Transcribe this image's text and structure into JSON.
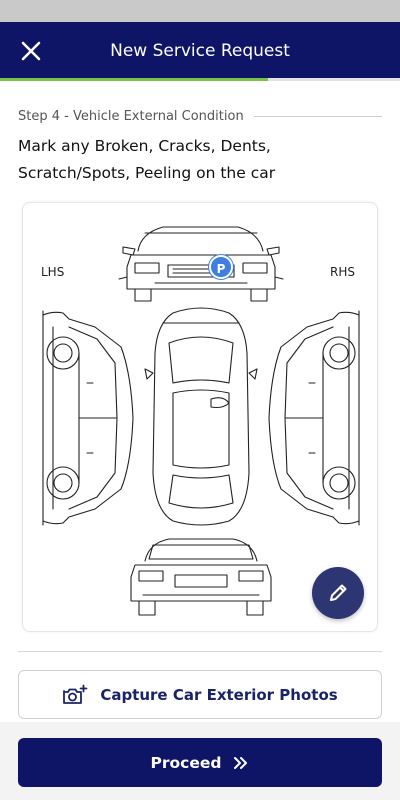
{
  "header": {
    "title": "New Service Request",
    "close_icon": "close-icon"
  },
  "progress": {
    "fraction": 0.67,
    "color": "#79c246"
  },
  "step": {
    "label": "Step 4 - Vehicle External Condition"
  },
  "instruction": "Mark any Broken, Cracks, Dents, Scratch/Spots, Peeling on the car",
  "diagram": {
    "lhs_label": "LHS",
    "rhs_label": "RHS",
    "marker_label": "P"
  },
  "actions": {
    "capture_label": "Capture Car Exterior Photos",
    "capture_icon": "add-camera-icon",
    "proceed_label": "Proceed",
    "proceed_icon": "double-chevron-right-icon",
    "edit_icon": "pencil-icon"
  },
  "colors": {
    "primary": "#0e1466",
    "accent": "#79c246",
    "marker": "#3f7fe0",
    "fab": "#2e3573"
  }
}
